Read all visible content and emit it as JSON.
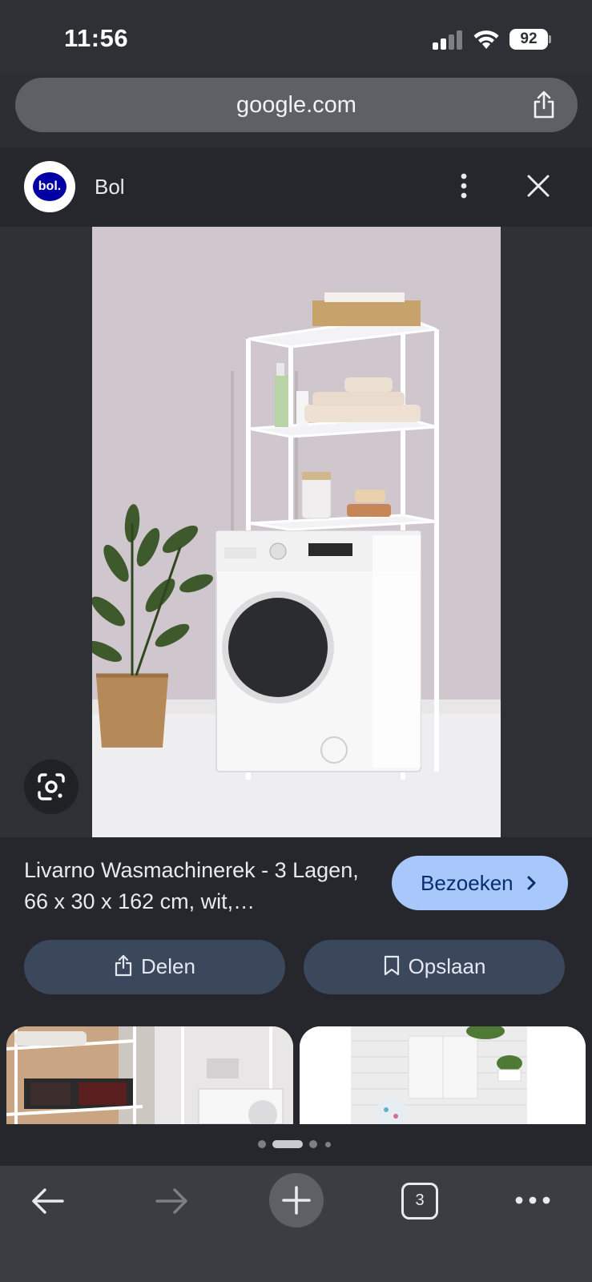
{
  "status_bar": {
    "time": "11:56",
    "battery": "92"
  },
  "browser": {
    "url": "google.com"
  },
  "source": {
    "logo_text": "bol.",
    "name": "Bol"
  },
  "product": {
    "title": "Livarno Wasmachinerek - 3 Lagen, 66 x 30 x 162 cm, wit,…",
    "visit_label": "Bezoeken",
    "share_label": "Delen",
    "save_label": "Opslaan"
  },
  "toolbar": {
    "tab_count": "3"
  },
  "colors": {
    "accent": "#a8c7fa",
    "action_bg": "#3b475b",
    "sheet_bg": "#25272c"
  }
}
